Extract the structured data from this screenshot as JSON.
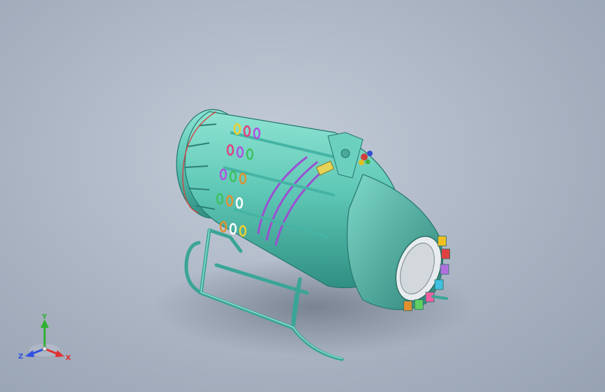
{
  "viewport": {
    "background_colors": [
      "#c4ccd8",
      "#96a1b2"
    ]
  },
  "model": {
    "primary_color": "#5fc8b6",
    "ring_color": "#9b4fd0",
    "tip_segment_colors": [
      "#f0c020",
      "#e04040",
      "#b070e0",
      "#40c0e0",
      "#f060a0",
      "#60d060",
      "#e09030"
    ]
  },
  "triad": {
    "x_label": "X",
    "y_label": "Y",
    "z_label": "Z",
    "x_color": "#e03030",
    "y_color": "#30b030",
    "z_color": "#3050e0"
  }
}
